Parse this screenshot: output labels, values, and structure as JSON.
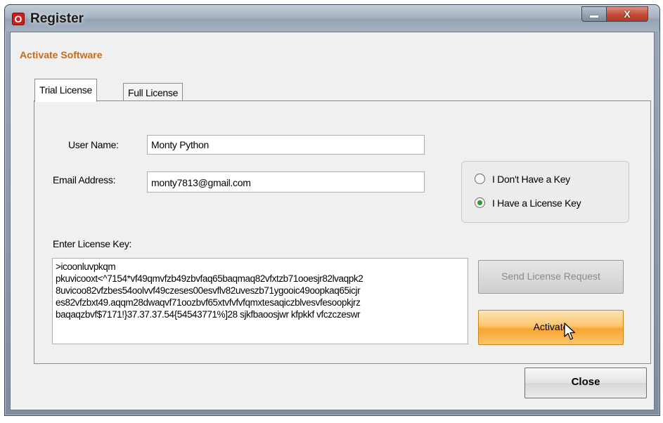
{
  "window": {
    "title": "Register",
    "app_icon_letter": "O",
    "close_glyph": "X"
  },
  "header": {
    "section_title": "Activate Software"
  },
  "tabs": [
    {
      "label": "Trial License",
      "selected": true
    },
    {
      "label": "Full License",
      "selected": false
    }
  ],
  "form": {
    "user_name_label": "User Name:",
    "user_name_value": "Monty Python",
    "email_label": "Email Address:",
    "email_value": "monty7813@gmail.com",
    "license_key_label": "Enter License Key:",
    "license_key_value": ">icoonluvpkqm\npkuvicooxt<^7154*vf49qmvfzb49zbvfaq65baqmaq82vfxtzb71ooesjr82lvaqpk2\n8uvicoo82vfzbes54oolvvf49czeses00esvflv82uveszb71ygooic49oopkaq65icjr\nes82vfzbxt49.aqqm28dwaqvf71oozbvf65xtvfvfvfqmxtesaqiczblvesvfesoopkjrz\nbaqaqzbvf$7171!}37.37.37.54{54543771%]28 sjkfbaoosjwr kfpkkf vfczczeswr"
  },
  "key_options": {
    "options": [
      {
        "label": "I Don't Have a Key",
        "selected": false
      },
      {
        "label": "I Have a License Key",
        "selected": true
      }
    ]
  },
  "buttons": {
    "send_license_request": "Send License Request",
    "activate": "Activate",
    "close": "Close"
  },
  "colors": {
    "section_title": "#c86a1a",
    "activate_button": "#f7a532",
    "radio_selected": "#2d9c2d"
  }
}
